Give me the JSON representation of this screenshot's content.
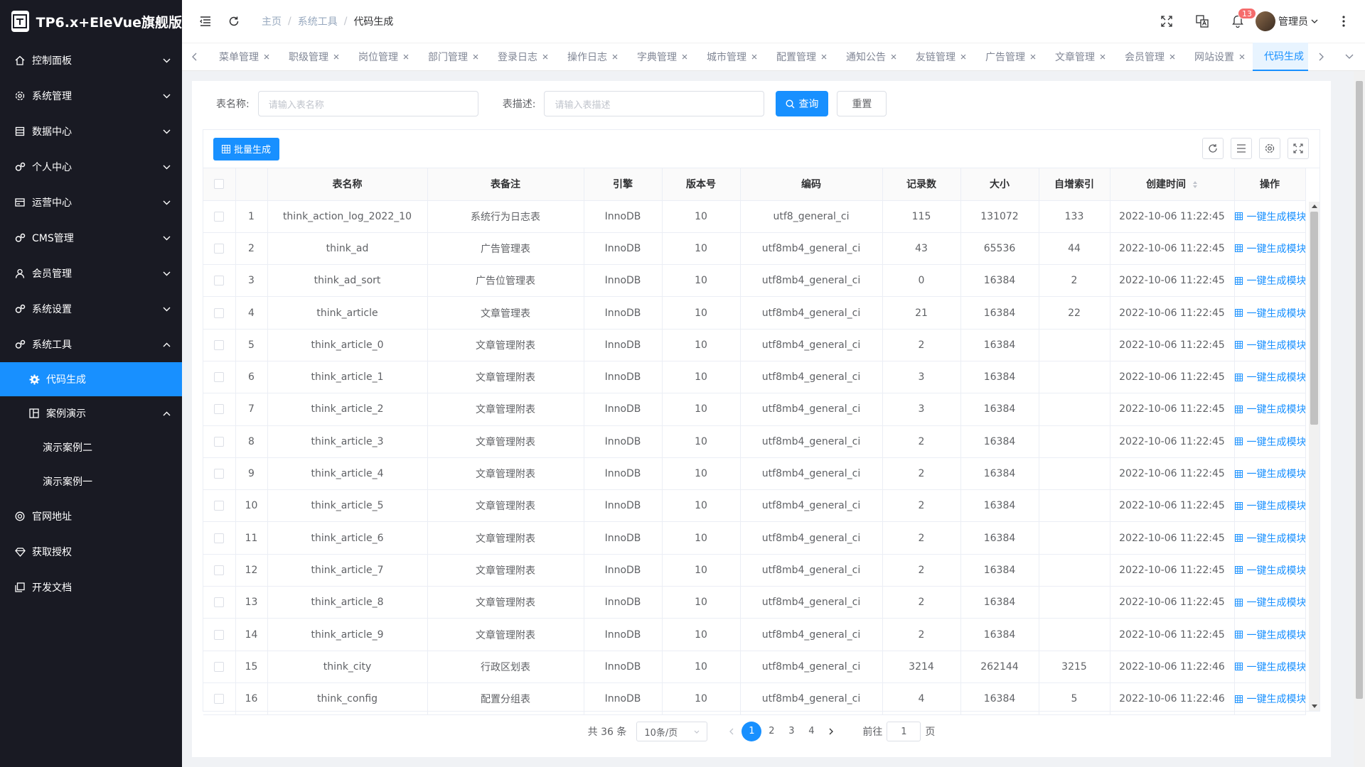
{
  "app": {
    "title": "TP6.x+EleVue旗舰版"
  },
  "sidebar": {
    "items": [
      {
        "label": "控制面板",
        "icon": "home-icon",
        "expanded": false
      },
      {
        "label": "系统管理",
        "icon": "settings-icon",
        "expanded": false
      },
      {
        "label": "数据中心",
        "icon": "database-icon",
        "expanded": false
      },
      {
        "label": "个人中心",
        "icon": "gears-icon",
        "expanded": false
      },
      {
        "label": "运营中心",
        "icon": "card-icon",
        "expanded": false
      },
      {
        "label": "CMS管理",
        "icon": "gears-icon",
        "expanded": false
      },
      {
        "label": "会员管理",
        "icon": "user-icon",
        "expanded": false
      },
      {
        "label": "系统设置",
        "icon": "gears-icon",
        "expanded": false
      },
      {
        "label": "系统工具",
        "icon": "gears-icon",
        "expanded": true
      }
    ],
    "tools_children": [
      {
        "label": "代码生成",
        "active": true
      },
      {
        "label": "案例演示",
        "expanded": true
      }
    ],
    "demo_children": [
      "演示案例二",
      "演示案例一"
    ],
    "bottom_items": [
      {
        "label": "官网地址",
        "icon": "globe-icon"
      },
      {
        "label": "获取授权",
        "icon": "diamond-icon"
      },
      {
        "label": "开发文档",
        "icon": "copy-icon"
      }
    ]
  },
  "header": {
    "breadcrumb": [
      "主页",
      "系统工具",
      "代码生成"
    ],
    "notification_count": "13",
    "user_name": "管理员"
  },
  "tabs": [
    "菜单管理",
    "职级管理",
    "岗位管理",
    "部门管理",
    "登录日志",
    "操作日志",
    "字典管理",
    "城市管理",
    "配置管理",
    "通知公告",
    "友链管理",
    "广告管理",
    "文章管理",
    "会员管理",
    "网站设置",
    "代码生成"
  ],
  "active_tab": "代码生成",
  "search": {
    "name_label": "表名称:",
    "name_placeholder": "请输入表名称",
    "desc_label": "表描述:",
    "desc_placeholder": "请输入表描述",
    "query_label": "查询",
    "reset_label": "重置"
  },
  "toolbar": {
    "batch_label": "批量生成"
  },
  "table": {
    "columns": [
      "表名称",
      "表备注",
      "引擎",
      "版本号",
      "编码",
      "记录数",
      "大小",
      "自增索引",
      "创建时间",
      "操作"
    ],
    "action_label": "一键生成模块",
    "rows": [
      [
        "1",
        "think_action_log_2022_10",
        "系统行为日志表",
        "InnoDB",
        "10",
        "utf8_general_ci",
        "115",
        "131072",
        "133",
        "2022-10-06 11:22:45"
      ],
      [
        "2",
        "think_ad",
        "广告管理表",
        "InnoDB",
        "10",
        "utf8mb4_general_ci",
        "43",
        "65536",
        "44",
        "2022-10-06 11:22:45"
      ],
      [
        "3",
        "think_ad_sort",
        "广告位管理表",
        "InnoDB",
        "10",
        "utf8mb4_general_ci",
        "0",
        "16384",
        "2",
        "2022-10-06 11:22:45"
      ],
      [
        "4",
        "think_article",
        "文章管理表",
        "InnoDB",
        "10",
        "utf8mb4_general_ci",
        "21",
        "16384",
        "22",
        "2022-10-06 11:22:45"
      ],
      [
        "5",
        "think_article_0",
        "文章管理附表",
        "InnoDB",
        "10",
        "utf8mb4_general_ci",
        "2",
        "16384",
        "",
        "2022-10-06 11:22:45"
      ],
      [
        "6",
        "think_article_1",
        "文章管理附表",
        "InnoDB",
        "10",
        "utf8mb4_general_ci",
        "3",
        "16384",
        "",
        "2022-10-06 11:22:45"
      ],
      [
        "7",
        "think_article_2",
        "文章管理附表",
        "InnoDB",
        "10",
        "utf8mb4_general_ci",
        "3",
        "16384",
        "",
        "2022-10-06 11:22:45"
      ],
      [
        "8",
        "think_article_3",
        "文章管理附表",
        "InnoDB",
        "10",
        "utf8mb4_general_ci",
        "2",
        "16384",
        "",
        "2022-10-06 11:22:45"
      ],
      [
        "9",
        "think_article_4",
        "文章管理附表",
        "InnoDB",
        "10",
        "utf8mb4_general_ci",
        "2",
        "16384",
        "",
        "2022-10-06 11:22:45"
      ],
      [
        "10",
        "think_article_5",
        "文章管理附表",
        "InnoDB",
        "10",
        "utf8mb4_general_ci",
        "2",
        "16384",
        "",
        "2022-10-06 11:22:45"
      ],
      [
        "11",
        "think_article_6",
        "文章管理附表",
        "InnoDB",
        "10",
        "utf8mb4_general_ci",
        "2",
        "16384",
        "",
        "2022-10-06 11:22:45"
      ],
      [
        "12",
        "think_article_7",
        "文章管理附表",
        "InnoDB",
        "10",
        "utf8mb4_general_ci",
        "2",
        "16384",
        "",
        "2022-10-06 11:22:45"
      ],
      [
        "13",
        "think_article_8",
        "文章管理附表",
        "InnoDB",
        "10",
        "utf8mb4_general_ci",
        "2",
        "16384",
        "",
        "2022-10-06 11:22:45"
      ],
      [
        "14",
        "think_article_9",
        "文章管理附表",
        "InnoDB",
        "10",
        "utf8mb4_general_ci",
        "2",
        "16384",
        "",
        "2022-10-06 11:22:45"
      ],
      [
        "15",
        "think_city",
        "行政区划表",
        "InnoDB",
        "10",
        "utf8mb4_general_ci",
        "3214",
        "262144",
        "3215",
        "2022-10-06 11:22:46"
      ],
      [
        "16",
        "think_config",
        "配置分组表",
        "InnoDB",
        "10",
        "utf8mb4_general_ci",
        "4",
        "16384",
        "5",
        "2022-10-06 11:22:46"
      ]
    ]
  },
  "pagination": {
    "total": "共 36 条",
    "page_size": "10条/页",
    "pages": [
      "1",
      "2",
      "3",
      "4"
    ],
    "current": "1",
    "goto_label": "前往",
    "goto_value": "1",
    "page_suffix": "页"
  },
  "colors": {
    "primary": "#1890ff",
    "sidebar_bg": "#191a23",
    "badge": "#f56c6c"
  }
}
